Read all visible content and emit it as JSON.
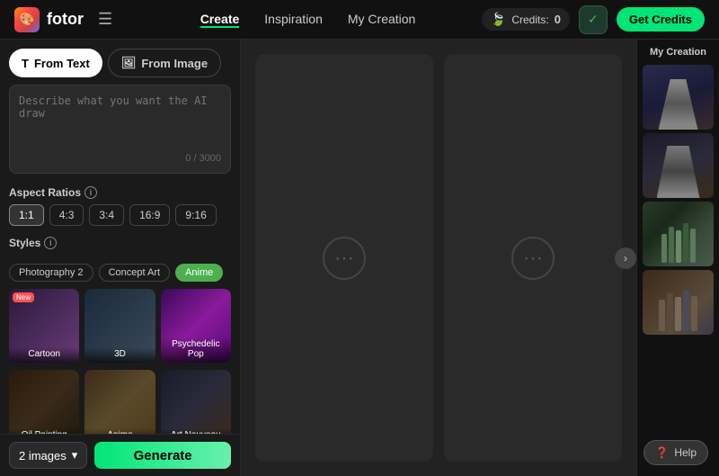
{
  "header": {
    "logo_text": "fotor",
    "nav_items": [
      {
        "label": "Create",
        "active": true
      },
      {
        "label": "Inspiration",
        "active": false
      },
      {
        "label": "My Creation",
        "active": false
      }
    ],
    "credits_label": "Credits:",
    "credits_value": "0",
    "get_credits_label": "Get Credits"
  },
  "tabs": {
    "from_text_label": "From Text",
    "from_image_label": "From Image"
  },
  "prompt": {
    "placeholder": "Describe what you want the AI draw",
    "count": "0 / 3000"
  },
  "aspect_ratios": {
    "title": "Aspect Ratios",
    "options": [
      "1:1",
      "4:3",
      "3:4",
      "16:9",
      "9:16"
    ],
    "active": "1:1"
  },
  "styles": {
    "title": "Styles",
    "tags": [
      {
        "label": "Photography 2",
        "active": false
      },
      {
        "label": "Concept Art",
        "active": false
      },
      {
        "label": "Anime",
        "active": true
      }
    ],
    "cards": [
      {
        "label": "Cartoon",
        "new": true,
        "class": "sc-cartoon"
      },
      {
        "label": "3D",
        "new": false,
        "class": "sc-3d"
      },
      {
        "label": "Psychedelic Pop",
        "new": false,
        "class": "sc-psychedelic"
      },
      {
        "label": "Oil Painting",
        "new": false,
        "class": "sc-oil"
      },
      {
        "label": "Anime",
        "new": false,
        "class": "sc-anime"
      },
      {
        "label": "Art Nouveau",
        "new": false,
        "class": "sc-art"
      }
    ]
  },
  "bottom_bar": {
    "images_label": "2 images",
    "generate_label": "Generate"
  },
  "right_panel": {
    "title": "My Creation",
    "thumbs": [
      "thumb-1",
      "thumb-2",
      "thumb-3",
      "thumb-4"
    ]
  },
  "help": {
    "label": "Help"
  }
}
